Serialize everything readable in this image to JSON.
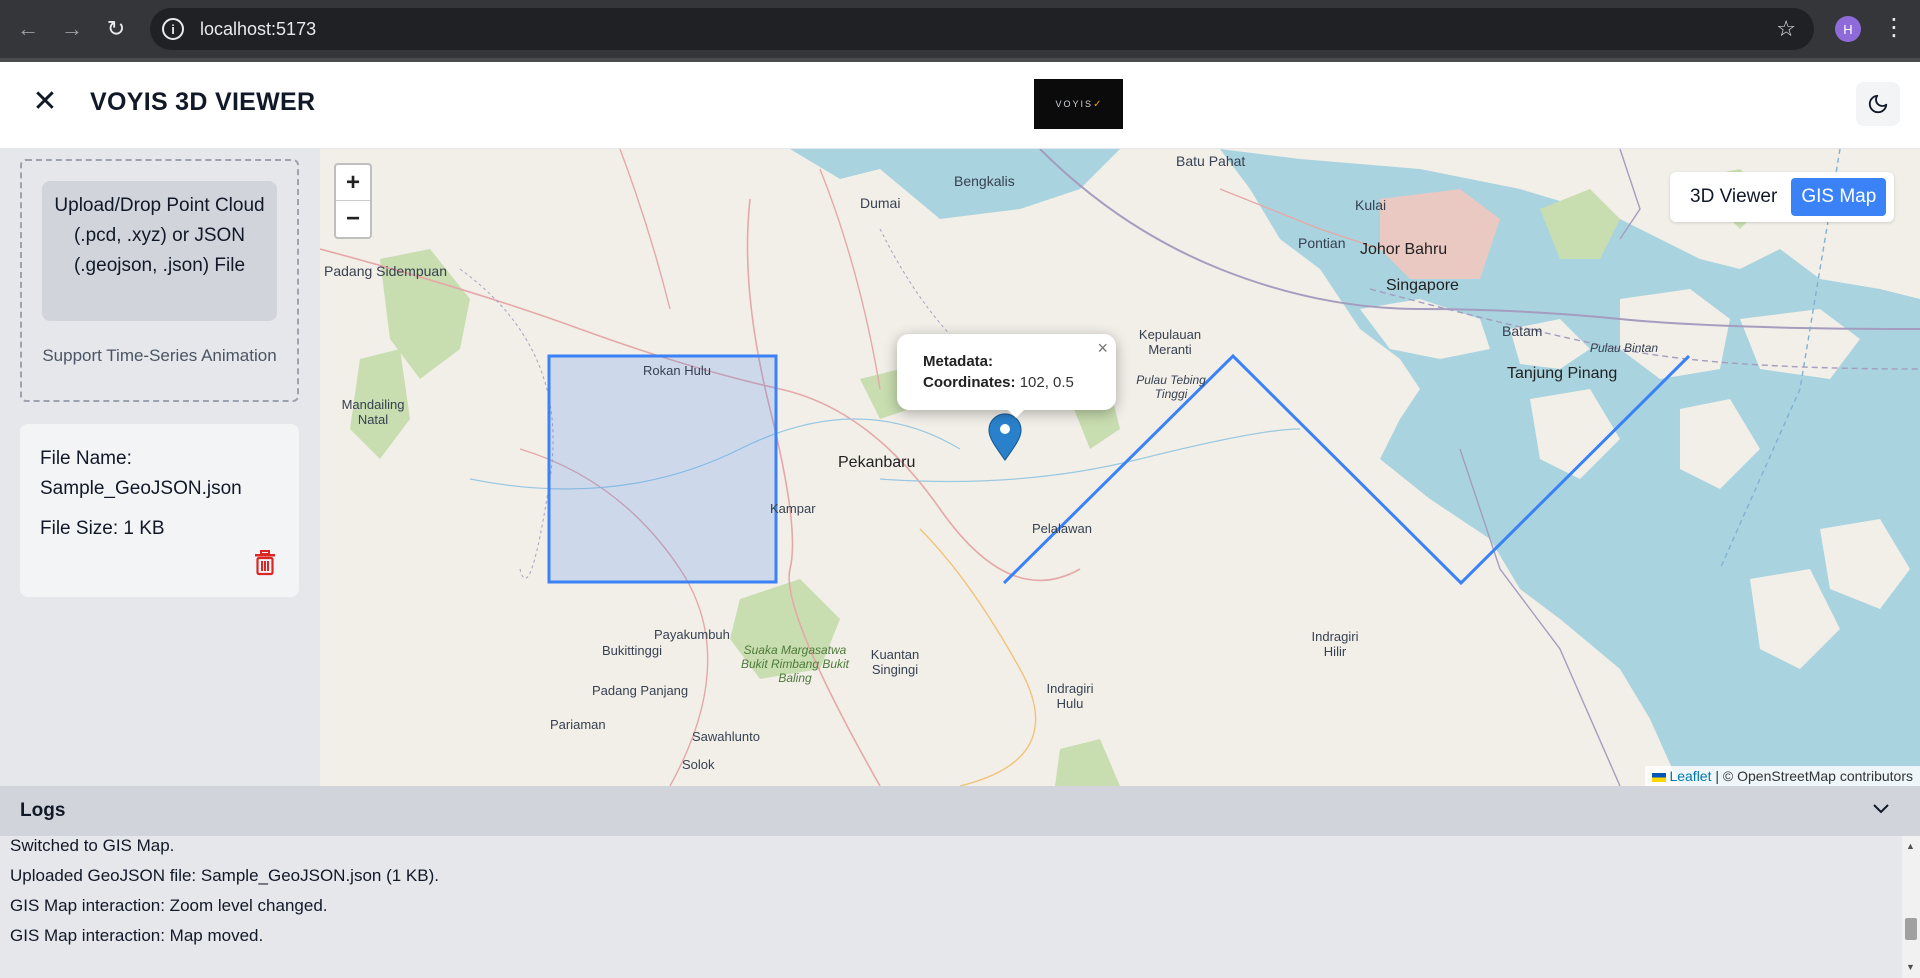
{
  "browser": {
    "url": "localhost:5173",
    "profile_initial": "H"
  },
  "header": {
    "title": "VOYIS 3D VIEWER",
    "logo_text": "VOYIS",
    "close_icon": "close-icon",
    "theme_icon": "moon-icon"
  },
  "sidebar": {
    "upload_label": "Upload/Drop Point Cloud (.pcd, .xyz) or JSON (.geojson, .json) File",
    "support_text": "Support Time-Series Animation",
    "file_name_label": "File Name:",
    "file_name": "Sample_GeoJSON.json",
    "file_size": "File Size: 1 KB"
  },
  "map": {
    "zoom_in": "+",
    "zoom_out": "−",
    "view_toggle": {
      "options": [
        "3D Viewer",
        "GIS Map"
      ],
      "selected": "GIS Map"
    },
    "popup": {
      "metadata_label": "Metadata:",
      "coordinates_label": "Coordinates:",
      "coordinates_value": "102, 0.5",
      "close": "×"
    },
    "attribution_leaflet": "Leaflet",
    "attribution_rest": " | © OpenStreetMap contributors",
    "labels": {
      "pekanbaru": "Pekanbaru",
      "batu_pahat": "Batu Pahat",
      "johor_bahru": "Johor Bahru",
      "singapore": "Singapore",
      "batam": "Batam",
      "tanjung_pinang": "Tanjung Pinang",
      "pulau_bintan": "Pulau Bintan",
      "kulai": "Kulai",
      "pontian": "Pontian",
      "dumai": "Dumai",
      "bengkalis": "Bengkalis",
      "padang_sidempuan": "Padang Sidempuan",
      "rokan_hulu": "Rokan Hulu",
      "mandailing_natal": "Mandailing Natal",
      "kampar": "Kampar",
      "pelalawan": "Pelalawan",
      "kepulauan_meranti": "Kepulauan Meranti",
      "pulau_tebing_tinggi": "Pulau Tebing Tinggi",
      "payakumbuh": "Payakumbuh",
      "bukittinggi": "Bukittinggi",
      "padang_panjang": "Padang Panjang",
      "pariaman": "Pariaman",
      "sawahlunto": "Sawahlunto",
      "solok": "Solok",
      "kuantan_singingi": "Kuantan Singingi",
      "indragiri_hulu": "Indragiri Hulu",
      "indragiri_hilir": "Indragiri Hilir",
      "suaka": "Suaka Margasatwa Bukit Rimbang Bukit Baling"
    }
  },
  "logs": {
    "title": "Logs",
    "lines": [
      "Switched to GIS Map.",
      "Uploaded GeoJSON file: Sample_GeoJSON.json (1 KB).",
      "GIS Map interaction: Zoom level changed.",
      "GIS Map interaction: Map moved."
    ]
  },
  "colors": {
    "accent": "#3b82f6",
    "map_water": "#a9d3df",
    "map_land": "#f2efe9",
    "delete_icon": "#dc2626"
  }
}
